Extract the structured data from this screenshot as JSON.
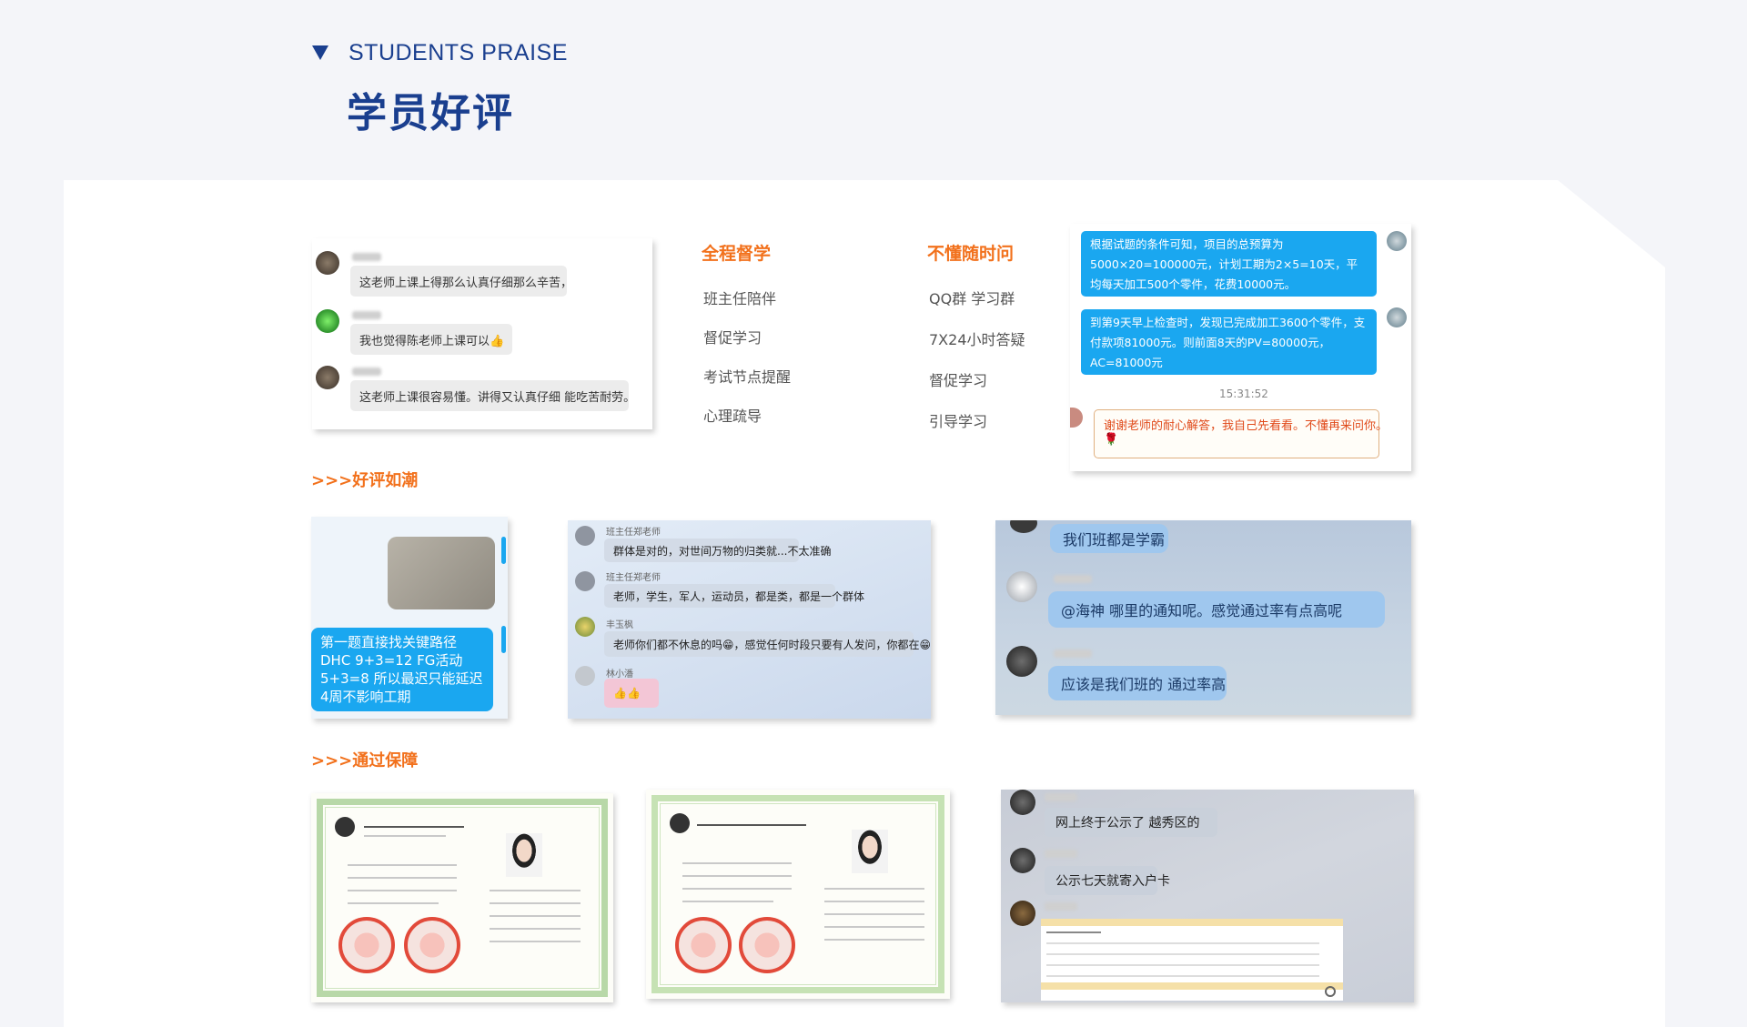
{
  "header": {
    "en_title": "STUDENTS PRAISE",
    "cn_title": "学员好评"
  },
  "chat_card": {
    "messages": [
      {
        "text": "这老师上课上得那么认真仔细那么辛苦，"
      },
      {
        "text": "我也觉得陈老师上课可以👍"
      },
      {
        "text": "这老师上课很容易懂。讲得又认真仔细 能吃苦耐劳。"
      }
    ]
  },
  "features": {
    "col1": {
      "title": "全程督学",
      "items": [
        "班主任陪伴",
        "督促学习",
        "考试节点提醒",
        "心理疏导"
      ]
    },
    "col2": {
      "title": "不懂随时问",
      "items": [
        "QQ群 学习群",
        "7X24小时答疑",
        "督促学习",
        "引导学习"
      ]
    }
  },
  "answer_card": {
    "msg1": "根据试题的条件可知，项目的总预算为5000×20=100000元，计划工期为2×5=10天，平均每天加工500个零件，花费10000元。",
    "msg2": "到第9天早上检查时，发现已完成加工3600个零件，支付款项81000元。则前面8天的PV=80000元，AC=81000元",
    "time": "15:31:52",
    "reply": "谢谢老师的耐心解答，我自己先看看。不懂再来问你。"
  },
  "section1": {
    "label": ">>>好评如潮"
  },
  "review1": {
    "text": "第一题直接找关键路径 DHC 9+3=12  FG活动 5+3=8  所以最迟只能延迟4周不影响工期"
  },
  "review2": {
    "rows": [
      {
        "name": "班主任郑老师",
        "text": "群体是对的，对世间万物的归类就...不太准确"
      },
      {
        "name": "班主任郑老师",
        "text": "老师，学生，军人，运动员，都是类，都是一个群体"
      },
      {
        "name": "丰玉枫",
        "text": "老师你们都不休息的吗😁，感觉任何时段只要有人发问，你都在😁"
      },
      {
        "name": "林小潘",
        "text": "👍👍"
      }
    ]
  },
  "review3": {
    "msgs": [
      "我们班都是学霸",
      "@海神 哪里的通知呢。感觉通过率有点高呢",
      "应该是我们班的 通过率高"
    ]
  },
  "section2": {
    "label": ">>>通过保障"
  },
  "pass3": {
    "msgs": [
      "网上终于公示了 越秀区的",
      "公示七天就寄入户卡"
    ]
  },
  "colors": {
    "brand_blue": "#1a3f8f",
    "accent_orange": "#f2711c",
    "bubble_blue": "#1aa7f0"
  }
}
